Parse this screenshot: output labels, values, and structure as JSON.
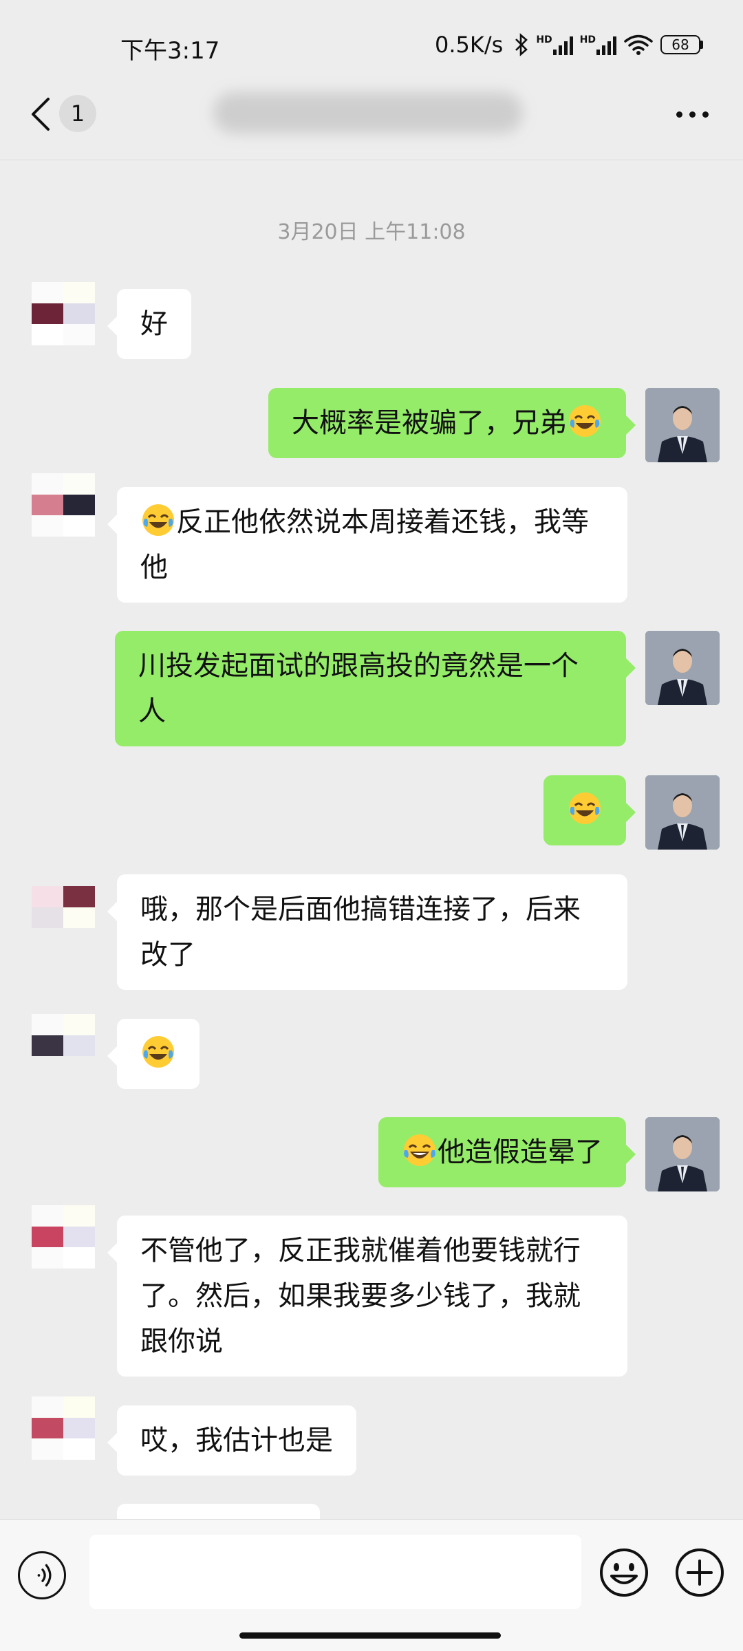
{
  "status_bar": {
    "time": "下午3:17",
    "network_speed": "0.5K/s",
    "signal_1_label": "HD",
    "signal_2_label": "HD",
    "battery": "68"
  },
  "nav": {
    "unread_count": "1"
  },
  "timestamp": "3月20日 上午11:08",
  "messages": [
    {
      "side": "in",
      "text": "好"
    },
    {
      "side": "out",
      "text": "大概率是被骗了，兄弟",
      "emoji_end": "laugh-cry"
    },
    {
      "side": "in",
      "text": "反正他依然说本周接着还钱，我等他",
      "emoji_start": "laugh-cry"
    },
    {
      "side": "out",
      "text": "川投发起面试的跟高投的竟然是一个人"
    },
    {
      "side": "out",
      "text": "",
      "emoji_only": "laugh-cry"
    },
    {
      "side": "in",
      "text": "哦，那个是后面他搞错连接了，后来改了"
    },
    {
      "side": "in",
      "text": "",
      "emoji_only": "laugh-cry"
    },
    {
      "side": "out",
      "text": "他造假造晕了",
      "emoji_start": "joy"
    },
    {
      "side": "in",
      "text": "不管他了，反正我就催着他要钱就行了。然后，如果我要多少钱了，我就跟你说"
    },
    {
      "side": "in",
      "text": "哎，我估计也是"
    }
  ],
  "colors": {
    "outgoing_bubble": "#95ec69",
    "incoming_bubble": "#ffffff",
    "background": "#ededed"
  }
}
